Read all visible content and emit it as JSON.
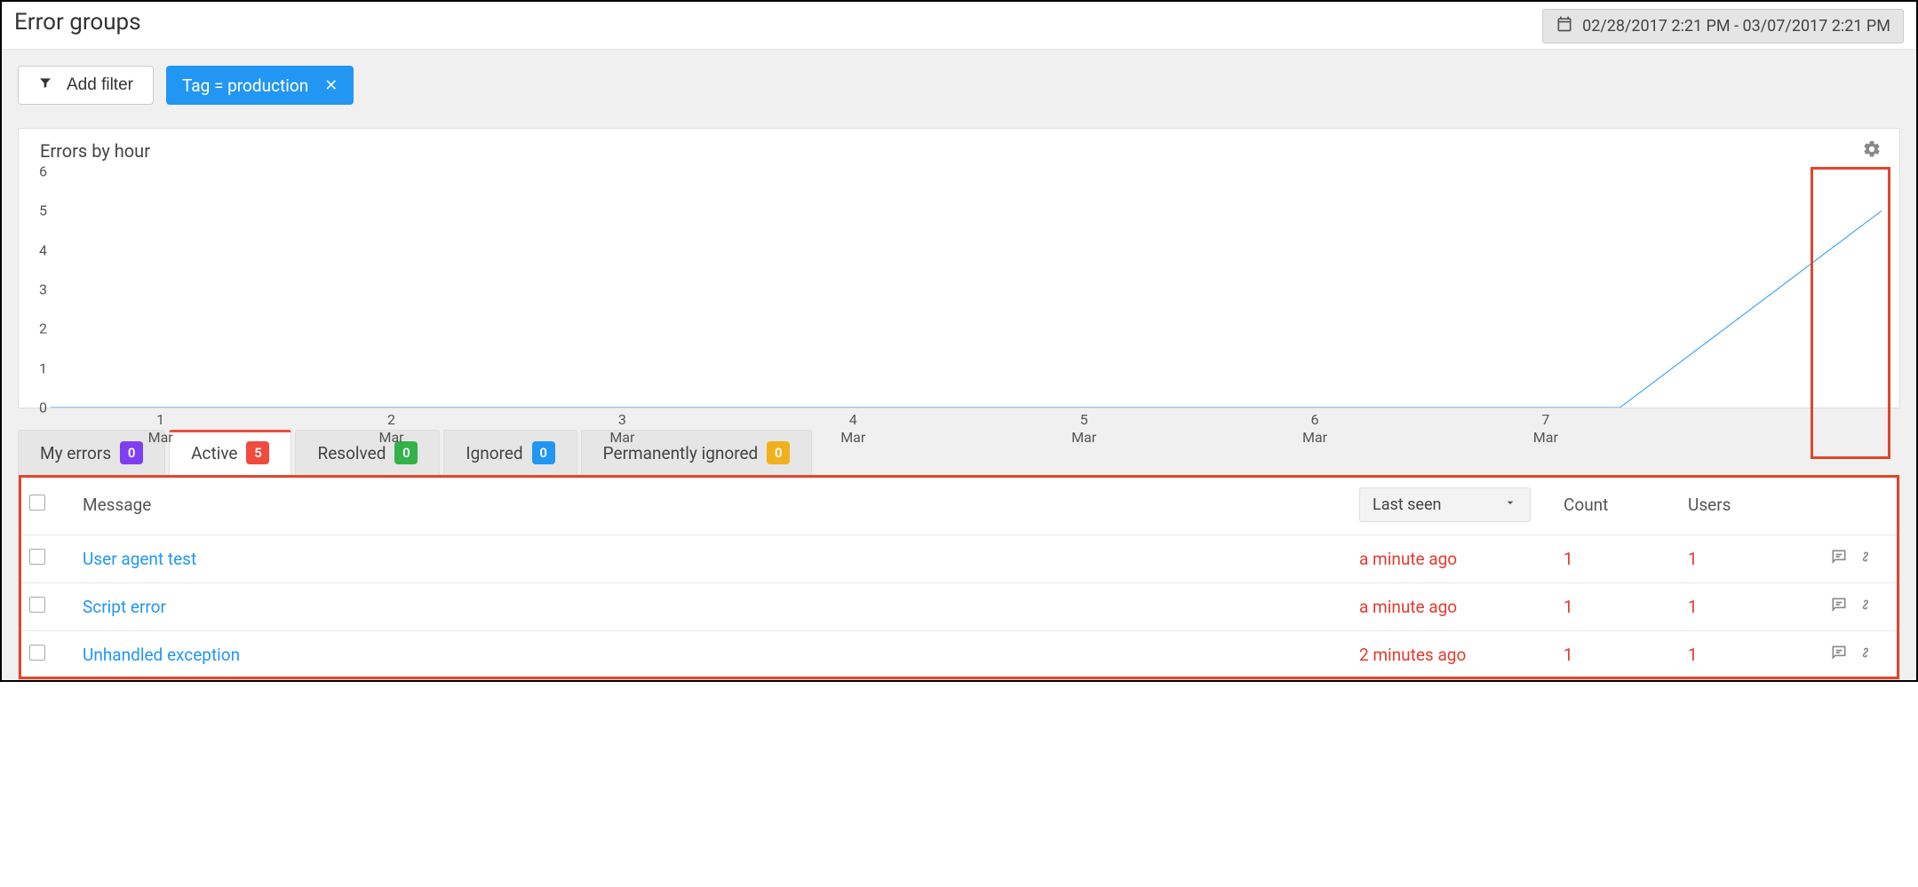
{
  "header": {
    "title": "Error groups",
    "date_range": "02/28/2017 2:21 PM - 03/07/2017 2:21 PM"
  },
  "filters": {
    "add_label": "Add filter",
    "chips": [
      {
        "label": "Tag = production"
      }
    ]
  },
  "chart": {
    "title": "Errors by hour"
  },
  "chart_data": {
    "type": "line",
    "title": "Errors by hour",
    "xlabel": "",
    "ylabel": "",
    "ylim": [
      0,
      6
    ],
    "yticks": [
      0,
      1,
      2,
      3,
      4,
      5,
      6
    ],
    "categories": [
      "1 Mar",
      "2 Mar",
      "3 Mar",
      "4 Mar",
      "5 Mar",
      "6 Mar",
      "7 Mar"
    ],
    "series": [
      {
        "name": "Errors",
        "color": "#2296f3",
        "values": [
          0,
          0,
          0,
          0,
          0,
          0,
          0,
          5
        ]
      }
    ],
    "x_tick_labels": [
      {
        "top": "1",
        "bottom": "Mar"
      },
      {
        "top": "2",
        "bottom": "Mar"
      },
      {
        "top": "3",
        "bottom": "Mar"
      },
      {
        "top": "4",
        "bottom": "Mar"
      },
      {
        "top": "5",
        "bottom": "Mar"
      },
      {
        "top": "6",
        "bottom": "Mar"
      },
      {
        "top": "7",
        "bottom": "Mar"
      }
    ]
  },
  "tabs": [
    {
      "label": "My errors",
      "count": "0",
      "badge_color": "purple",
      "active": false
    },
    {
      "label": "Active",
      "count": "5",
      "badge_color": "red",
      "active": true
    },
    {
      "label": "Resolved",
      "count": "0",
      "badge_color": "green",
      "active": false
    },
    {
      "label": "Ignored",
      "count": "0",
      "badge_color": "blue",
      "active": false
    },
    {
      "label": "Permanently ignored",
      "count": "0",
      "badge_color": "amber",
      "active": false
    }
  ],
  "table": {
    "columns": {
      "message": "Message",
      "last_seen": "Last seen",
      "count": "Count",
      "users": "Users"
    },
    "rows": [
      {
        "message": "User agent test",
        "last_seen": "a minute ago",
        "count": "1",
        "users": "1"
      },
      {
        "message": "Script error",
        "last_seen": "a minute ago",
        "count": "1",
        "users": "1"
      },
      {
        "message": "Unhandled exception",
        "last_seen": "2 minutes ago",
        "count": "1",
        "users": "1"
      }
    ]
  }
}
